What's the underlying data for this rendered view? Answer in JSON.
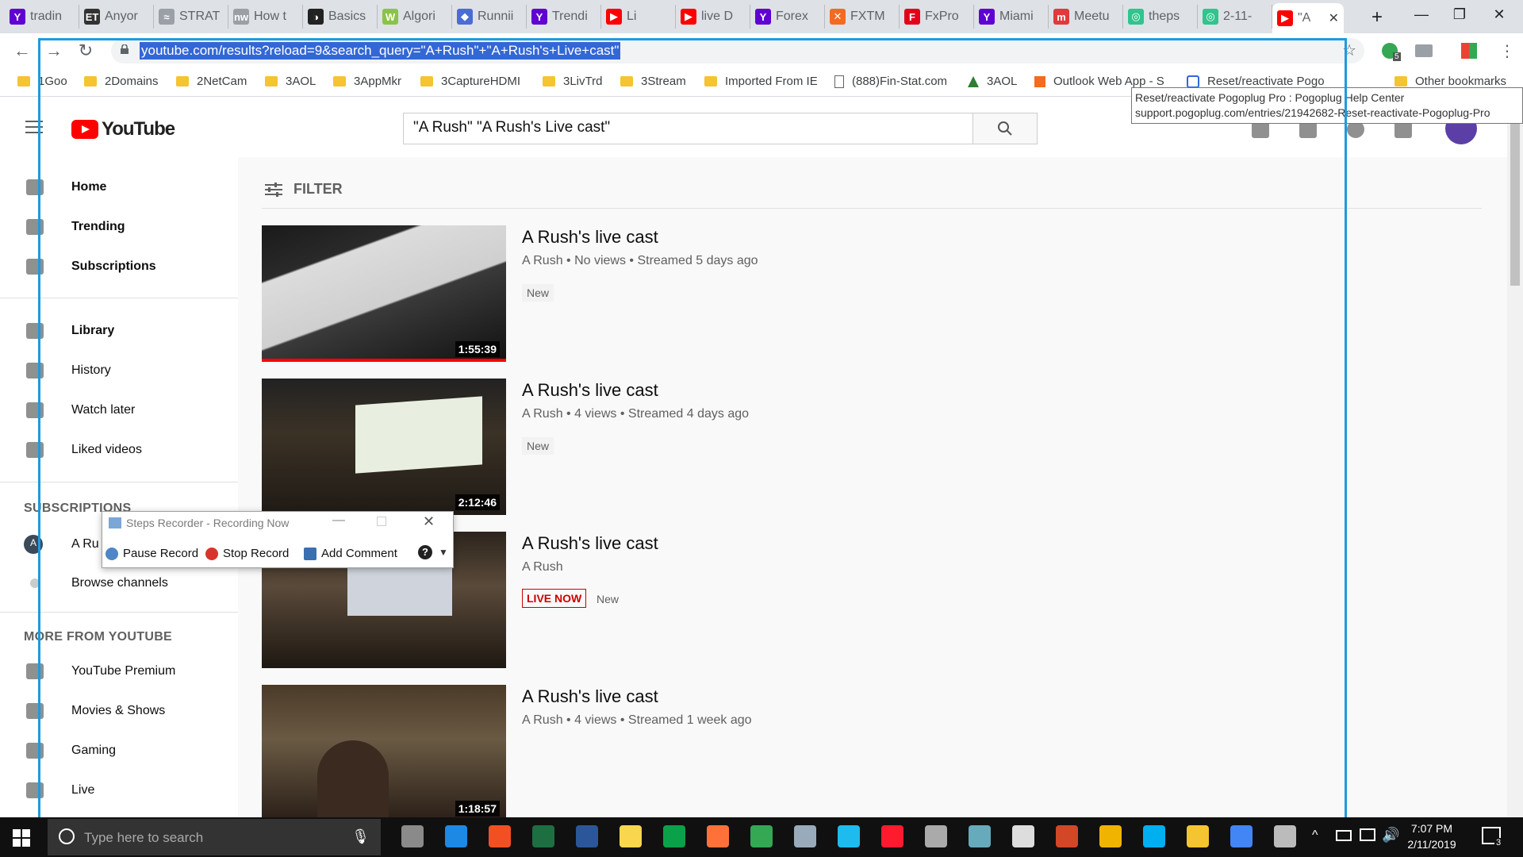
{
  "browser": {
    "tabs": [
      {
        "label": "tradin",
        "color": "#5f01d1",
        "glyph": "Y"
      },
      {
        "label": "Anyor",
        "color": "#333333",
        "glyph": "ET"
      },
      {
        "label": "STRAT",
        "color": "#9aa0a6",
        "glyph": "≈"
      },
      {
        "label": "How t",
        "color": "#9aa0a6",
        "glyph": "nw"
      },
      {
        "label": "Basics",
        "color": "#222222",
        "glyph": "◑"
      },
      {
        "label": "Algori",
        "color": "#8bc34a",
        "glyph": "W"
      },
      {
        "label": "Runnii",
        "color": "#4a6cd4",
        "glyph": "◆"
      },
      {
        "label": "Trendi",
        "color": "#5f01d1",
        "glyph": "Y"
      },
      {
        "label": "Li",
        "color": "#ff0000",
        "glyph": "▶"
      },
      {
        "label": "live D",
        "color": "#ff0000",
        "glyph": "▶"
      },
      {
        "label": "Forex",
        "color": "#5f01d1",
        "glyph": "Y"
      },
      {
        "label": "FXTM",
        "color": "#f26b21",
        "glyph": "✕"
      },
      {
        "label": "FxPro",
        "color": "#e2001a",
        "glyph": "F"
      },
      {
        "label": "Miami",
        "color": "#5f01d1",
        "glyph": "Y"
      },
      {
        "label": "Meetu",
        "color": "#e0393e",
        "glyph": "m"
      },
      {
        "label": "theps",
        "color": "#31c48d",
        "glyph": "◎"
      },
      {
        "label": "2-11-",
        "color": "#31c48d",
        "glyph": "◎"
      }
    ],
    "active_tab": {
      "label": "\"A",
      "color": "#ff0000",
      "glyph": "▶"
    },
    "new_tab": "+",
    "url": "youtube.com/results?reload=9&search_query=\"A+Rush\"+\"A+Rush's+Live+cast\"",
    "bookmarks": [
      {
        "label": "1Goo",
        "type": "folder"
      },
      {
        "label": "2Domains",
        "type": "folder"
      },
      {
        "label": "2NetCam",
        "type": "folder"
      },
      {
        "label": "3AOL",
        "type": "folder"
      },
      {
        "label": "3AppMkr",
        "type": "folder"
      },
      {
        "label": "3CaptureHDMI",
        "type": "folder"
      },
      {
        "label": "3LivTrd",
        "type": "folder"
      },
      {
        "label": "3Stream",
        "type": "folder"
      },
      {
        "label": "Imported From IE",
        "type": "folder"
      },
      {
        "label": "(888)Fin-Stat.com",
        "type": "page"
      },
      {
        "label": "3AOL",
        "type": "aol"
      },
      {
        "label": "Outlook Web App - S",
        "type": "outlook"
      },
      {
        "label": "Reset/reactivate Pogo",
        "type": "pogo"
      }
    ],
    "other_bookmarks": "Other bookmarks",
    "tooltip": {
      "line1": "Reset/reactivate Pogoplug Pro : Pogoplug Help Center",
      "line2": "support.pogoplug.com/entries/21942682-Reset-reactivate-Pogoplug-Pro"
    },
    "profile_badge": "5"
  },
  "youtube": {
    "logo_text": "YouTube",
    "search_value": "\"A Rush\" \"A Rush's Live cast\"",
    "sidebar": {
      "main": [
        {
          "label": "Home",
          "icon": "home-icon"
        },
        {
          "label": "Trending",
          "icon": "flame-icon"
        },
        {
          "label": "Subscriptions",
          "icon": "subscriptions-icon"
        }
      ],
      "library": [
        {
          "label": "Library",
          "icon": "folder-icon"
        },
        {
          "label": "History",
          "icon": "history-icon"
        },
        {
          "label": "Watch later",
          "icon": "clock-icon"
        },
        {
          "label": "Liked videos",
          "icon": "list-icon"
        }
      ],
      "subscriptions_heading": "SUBSCRIPTIONS",
      "subscriptions": [
        {
          "label": "A Ru",
          "avatar_letter": "A"
        },
        {
          "label": "Browse channels"
        }
      ],
      "more_heading": "MORE FROM YOUTUBE",
      "more": [
        {
          "label": "YouTube Premium",
          "icon": "youtube-icon"
        },
        {
          "label": "Movies & Shows",
          "icon": "film-icon"
        },
        {
          "label": "Gaming",
          "icon": "gamepad-icon"
        },
        {
          "label": "Live",
          "icon": "live-icon"
        }
      ]
    },
    "filter_label": "FILTER",
    "results": [
      {
        "title": "A Rush's live cast",
        "meta": "A Rush • No views • Streamed 5 days ago",
        "badge": "New",
        "duration": "1:55:39",
        "live": false
      },
      {
        "title": "A Rush's live cast",
        "meta": "A Rush • 4 views • Streamed 4 days ago",
        "badge": "New",
        "duration": "2:12:46",
        "live": false
      },
      {
        "title": "A Rush's live cast",
        "meta": "A Rush",
        "badge": "New",
        "live_label": "LIVE NOW",
        "live": true
      },
      {
        "title": "A Rush's live cast",
        "meta": "A Rush • 4 views • Streamed 1 week ago",
        "duration": "1:18:57",
        "live": false
      }
    ]
  },
  "steps_recorder": {
    "title": "Steps Recorder - Recording Now",
    "pause": "Pause Record",
    "stop": "Stop Record",
    "comment": "Add Comment"
  },
  "taskbar": {
    "search_placeholder": "Type here to search",
    "time": "7:07 PM",
    "date": "2/11/2019",
    "notification_count": "3"
  }
}
